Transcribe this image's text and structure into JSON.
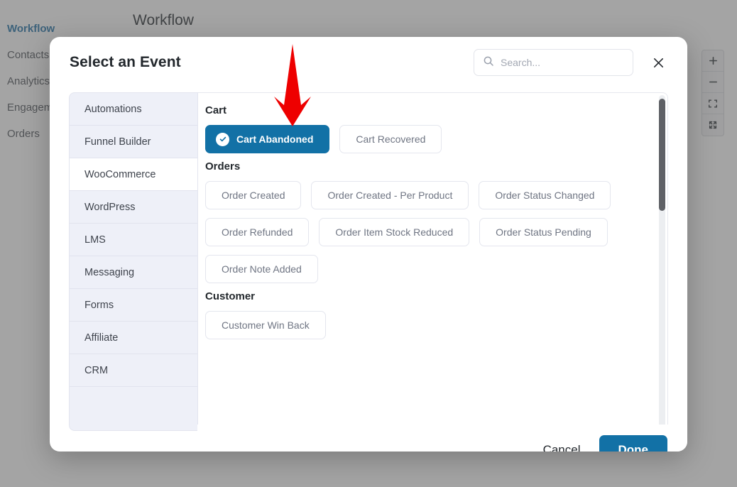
{
  "background": {
    "page_title": "Workflow",
    "nav": [
      {
        "label": "Workflow",
        "active": true
      },
      {
        "label": "Contacts",
        "active": false
      },
      {
        "label": "Analytics",
        "active": false
      },
      {
        "label": "Engagement",
        "active": false
      },
      {
        "label": "Orders",
        "active": false
      }
    ],
    "canvas_tools": [
      {
        "name": "zoom-in-icon",
        "label": "+"
      },
      {
        "name": "zoom-out-icon",
        "label": "−"
      },
      {
        "name": "fit-to-screen-icon",
        "label": ""
      },
      {
        "name": "expand-icon",
        "label": ""
      }
    ]
  },
  "modal": {
    "title": "Select an Event",
    "search": {
      "placeholder": "Search...",
      "value": "",
      "icon": "search-icon"
    },
    "close_icon": "close-icon",
    "categories": [
      {
        "label": "Automations",
        "active": false
      },
      {
        "label": "Funnel Builder",
        "active": false
      },
      {
        "label": "WooCommerce",
        "active": true
      },
      {
        "label": "WordPress",
        "active": false
      },
      {
        "label": "LMS",
        "active": false
      },
      {
        "label": "Messaging",
        "active": false
      },
      {
        "label": "Forms",
        "active": false
      },
      {
        "label": "Affiliate",
        "active": false
      },
      {
        "label": "CRM",
        "active": false
      }
    ],
    "groups": [
      {
        "title": "Cart",
        "events": [
          {
            "label": "Cart Abandoned",
            "selected": true
          },
          {
            "label": "Cart Recovered",
            "selected": false
          }
        ]
      },
      {
        "title": "Orders",
        "events": [
          {
            "label": "Order Created",
            "selected": false
          },
          {
            "label": "Order Created - Per Product",
            "selected": false
          },
          {
            "label": "Order Status Changed",
            "selected": false
          },
          {
            "label": "Order Refunded",
            "selected": false
          },
          {
            "label": "Order Item Stock Reduced",
            "selected": false
          },
          {
            "label": "Order Status Pending",
            "selected": false
          },
          {
            "label": "Order Note Added",
            "selected": false
          }
        ]
      },
      {
        "title": "Customer",
        "events": [
          {
            "label": "Customer Win Back",
            "selected": false
          }
        ]
      }
    ],
    "footer": {
      "cancel_label": "Cancel",
      "done_label": "Done"
    }
  },
  "annotation": {
    "arrow_color": "#ee0000",
    "points_at": "Cart Abandoned"
  },
  "colors": {
    "accent": "#1271a6",
    "nav_active": "#1c6ea4",
    "sidebar_bg": "#eef0f8",
    "chip_text": "#6f7583",
    "scrollbar_thumb": "#5f6166"
  }
}
